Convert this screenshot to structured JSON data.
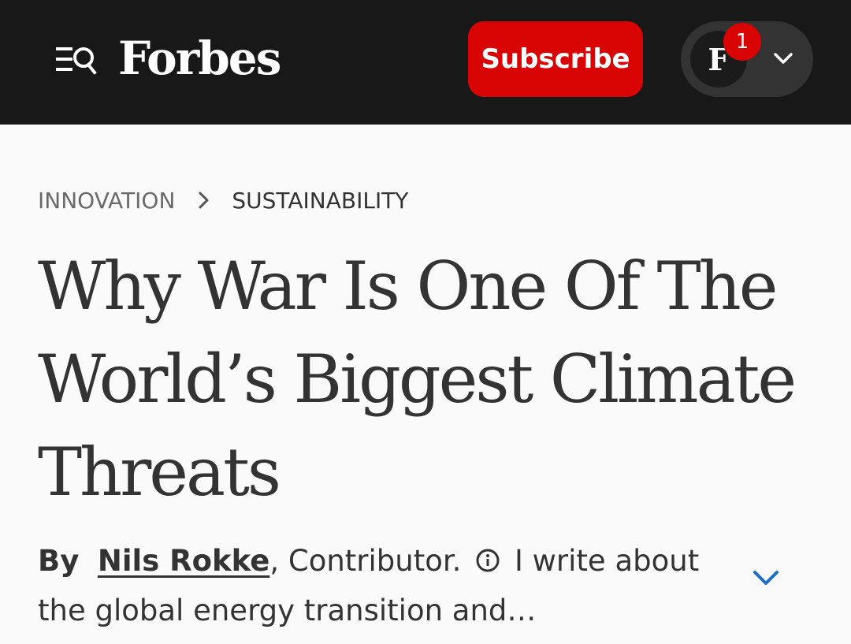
{
  "header": {
    "logo_text": "Forbes",
    "subscribe_label": "Subscribe",
    "avatar_letter": "F",
    "notification_count": "1",
    "icons": [
      "menu-icon",
      "search-icon",
      "chevron-down-icon"
    ],
    "colors": {
      "background": "#181818",
      "accent": "#d90404"
    }
  },
  "breadcrumb": {
    "items": [
      "INNOVATION",
      "SUSTAINABILITY"
    ]
  },
  "article": {
    "title": "Why War Is One Of The World’s Biggest Climate Threats",
    "byline": {
      "prefix": "By",
      "author": "Nils Rokke",
      "separator": ",",
      "role": "Contributor.",
      "bio": "I write about the global energy transition and…"
    }
  }
}
